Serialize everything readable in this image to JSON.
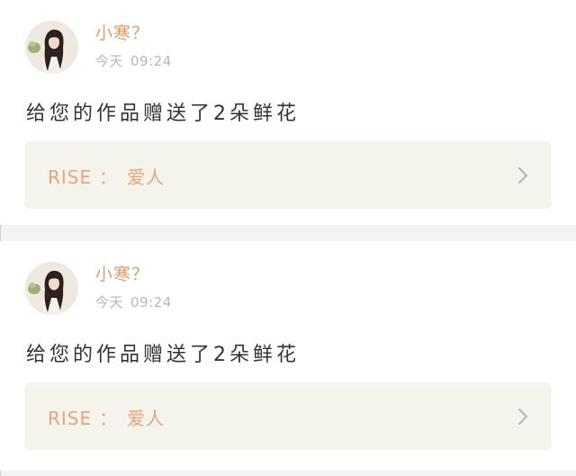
{
  "notifications": [
    {
      "username": "小寒？",
      "day": "今天",
      "time": "09:24",
      "message": "给您的作品赠送了2朵鲜花",
      "work": {
        "name": "RISE",
        "separator": "：",
        "title": "爱人"
      },
      "avatar_icon": "user-avatar-photo",
      "chevron_icon": "chevron-right-icon"
    },
    {
      "username": "小寒？",
      "day": "今天",
      "time": "09:24",
      "message": "给您的作品赠送了2朵鲜花",
      "work": {
        "name": "RISE",
        "separator": "：",
        "title": "爱人"
      },
      "avatar_icon": "user-avatar-photo",
      "chevron_icon": "chevron-right-icon"
    }
  ],
  "colors": {
    "username": "#e09a6b",
    "link_text": "#e6a47c",
    "link_bg": "#f5f4ec",
    "timestamp": "#b7b7b7",
    "page_bg": "#f3f3f3"
  }
}
